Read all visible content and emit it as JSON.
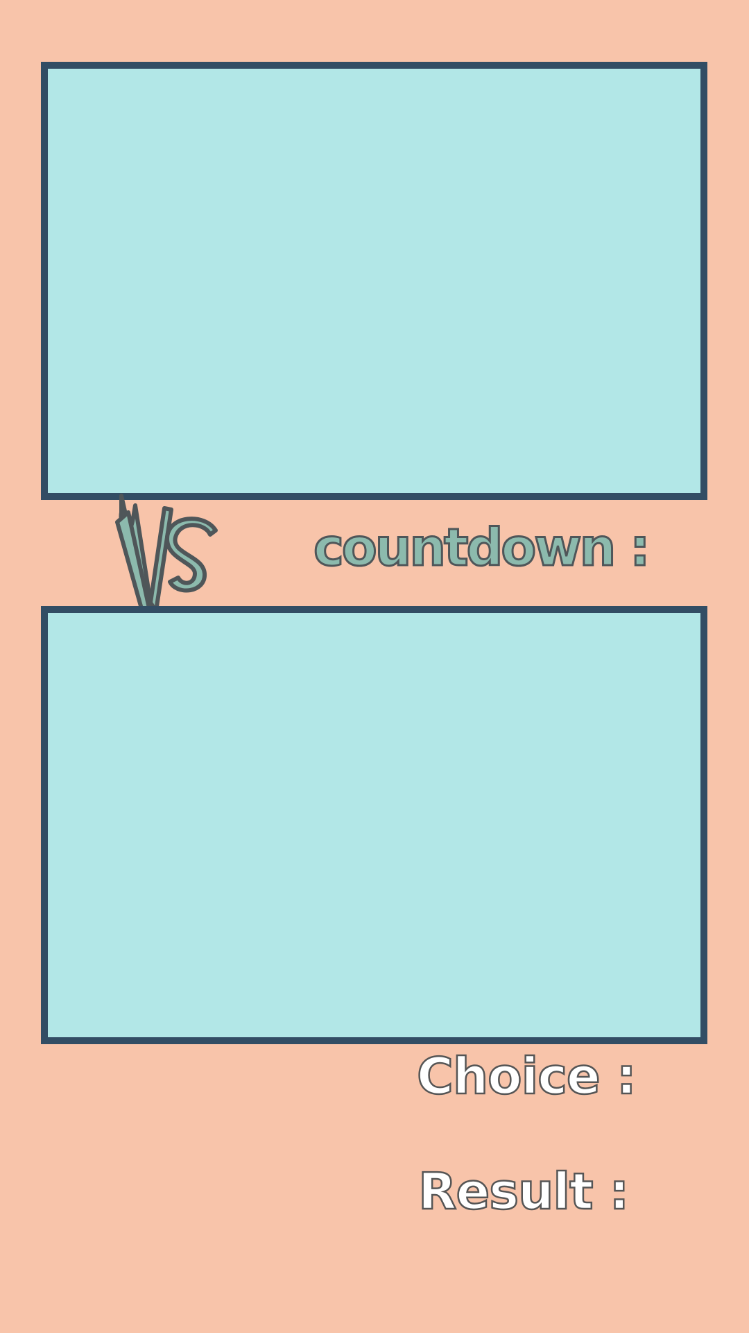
{
  "colors": {
    "background": "#F8C4AA",
    "panel_fill": "#B2E7E7",
    "panel_border": "#324D64",
    "vs_fill": "#8CBAAD",
    "vs_outline": "#4F5659",
    "label_fill": "#FFFFFF",
    "label_outline": "#555555"
  },
  "panels": {
    "opponent_panel": "opponent-display-panel",
    "player_panel": "player-display-panel"
  },
  "vs": {
    "text": "VS"
  },
  "countdown": {
    "label": "countdown :"
  },
  "choice": {
    "label": "Choice :"
  },
  "result": {
    "label": "Result :"
  }
}
